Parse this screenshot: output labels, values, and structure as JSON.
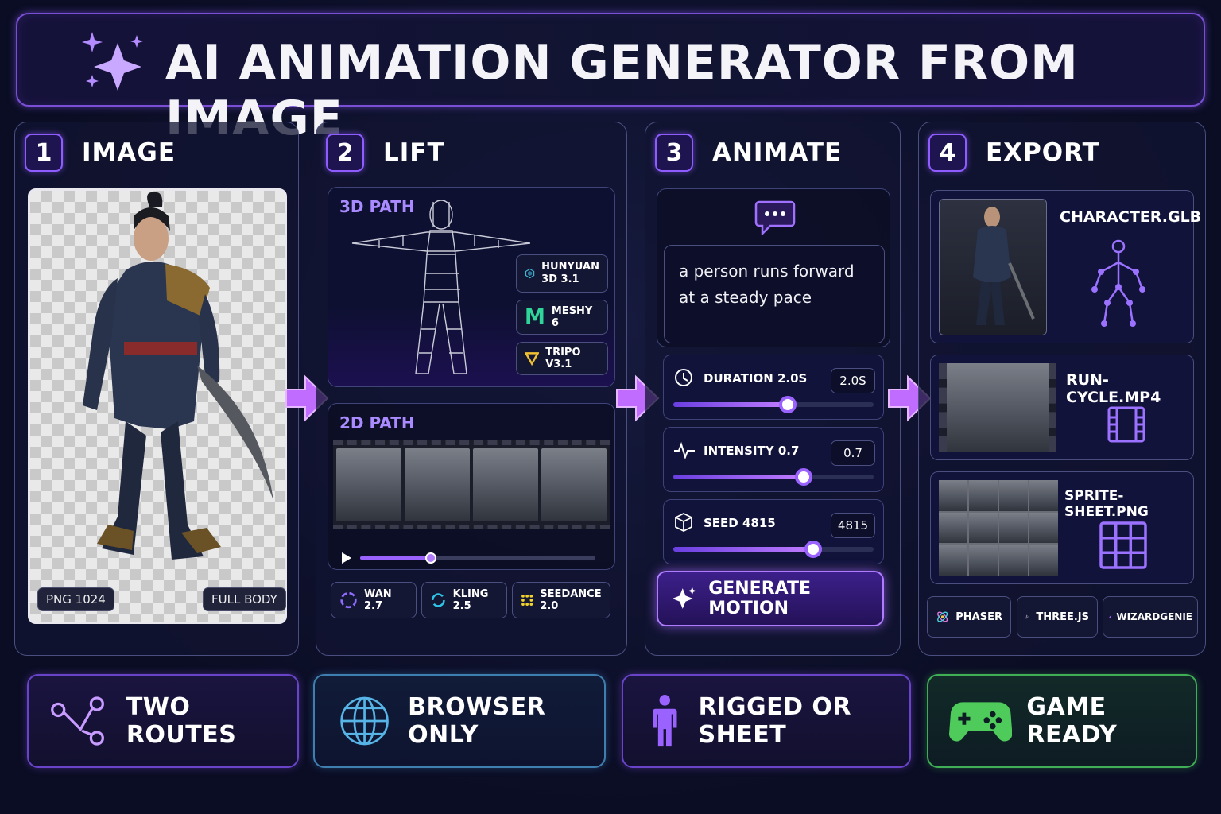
{
  "header": {
    "title": "AI ANIMATION GENERATOR FROM IMAGE",
    "icon": "sparkles-icon"
  },
  "steps": [
    {
      "number": "1",
      "title": "IMAGE"
    },
    {
      "number": "2",
      "title": "LIFT"
    },
    {
      "number": "3",
      "title": "ANIMATE"
    },
    {
      "number": "4",
      "title": "EXPORT"
    }
  ],
  "image_panel": {
    "format_badge": "PNG 1024",
    "type_badge": "FULL BODY"
  },
  "lift_panel": {
    "path3d_label": "3D PATH",
    "models3d": [
      {
        "name_line1": "HUNYUAN",
        "name_line2": "3D 3.1"
      },
      {
        "name": "MESHY 6"
      },
      {
        "name": "TRIPO V3.1"
      }
    ],
    "path2d_label": "2D PATH",
    "video_progress": 0.3,
    "models2d": [
      {
        "name": "WAN 2.7"
      },
      {
        "name": "KLING 2.5"
      },
      {
        "name": "SEEDANCE 2.0"
      }
    ]
  },
  "animate_panel": {
    "prompt": "a person runs forward at a steady pace",
    "sliders": [
      {
        "label": "DURATION 2.0S",
        "value": "2.0S",
        "fraction": 0.57
      },
      {
        "label": "INTENSITY 0.7",
        "value": "0.7",
        "fraction": 0.65
      },
      {
        "label": "SEED 4815",
        "value": "4815",
        "fraction": 0.7
      }
    ],
    "generate_label": "GENERATE MOTION"
  },
  "export_panel": {
    "files": [
      {
        "name": "CHARACTER.GLB",
        "icon": "skeleton-icon"
      },
      {
        "name": "RUN-CYCLE.MP4",
        "icon": "film-icon"
      },
      {
        "name": "SPRITE-SHEET.PNG",
        "icon": "grid-icon"
      }
    ],
    "engines": [
      {
        "name": "PHASER"
      },
      {
        "name": "THREE.JS"
      },
      {
        "name": "WIZARDGENIE"
      }
    ]
  },
  "features": [
    {
      "label": "TWO ROUTES",
      "icon": "route-icon",
      "color": "#8f5cff"
    },
    {
      "label": "BROWSER ONLY",
      "icon": "globe-icon",
      "color": "#4aa3d9"
    },
    {
      "label": "RIGGED OR SHEET",
      "icon": "person-icon",
      "color": "#8f5cff"
    },
    {
      "label": "GAME READY",
      "icon": "gamepad-icon",
      "color": "#4ecb5a"
    }
  ]
}
